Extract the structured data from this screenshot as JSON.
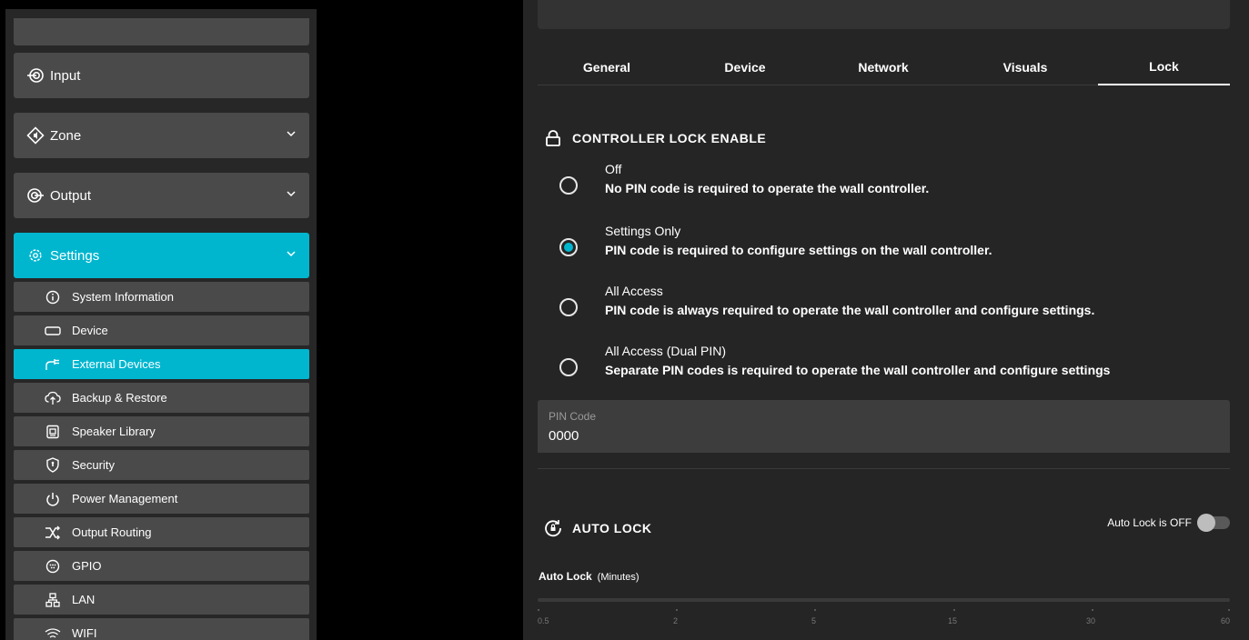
{
  "sidebar": {
    "nav": [
      {
        "label": "Input",
        "icon": "input-icon",
        "has_chevron": false
      },
      {
        "label": "Zone",
        "icon": "zone-icon",
        "has_chevron": true
      },
      {
        "label": "Output",
        "icon": "output-icon",
        "has_chevron": true
      },
      {
        "label": "Settings",
        "icon": "gear-icon",
        "has_chevron": true,
        "active": true
      }
    ],
    "sub": [
      {
        "label": "System Information",
        "icon": "info-icon"
      },
      {
        "label": "Device",
        "icon": "device-icon"
      },
      {
        "label": "External Devices",
        "icon": "external-devices-icon",
        "active": true
      },
      {
        "label": "Backup & Restore",
        "icon": "backup-icon"
      },
      {
        "label": "Speaker Library",
        "icon": "speaker-icon"
      },
      {
        "label": "Security",
        "icon": "shield-icon"
      },
      {
        "label": "Power Management",
        "icon": "power-icon"
      },
      {
        "label": "Output Routing",
        "icon": "routing-icon"
      },
      {
        "label": "GPIO",
        "icon": "gpio-icon"
      },
      {
        "label": "LAN",
        "icon": "lan-icon"
      },
      {
        "label": "WIFI",
        "icon": "wifi-icon"
      }
    ]
  },
  "tabs": [
    {
      "label": "General"
    },
    {
      "label": "Device"
    },
    {
      "label": "Network"
    },
    {
      "label": "Visuals"
    },
    {
      "label": "Lock",
      "active": true
    }
  ],
  "controller_lock": {
    "heading": "CONTROLLER LOCK ENABLE",
    "options": [
      {
        "title": "Off",
        "desc": "No PIN code is required to operate the wall controller.",
        "checked": false
      },
      {
        "title": "Settings Only",
        "desc": "PIN code is required to configure settings on the wall controller.",
        "checked": true
      },
      {
        "title": "All Access",
        "desc": "PIN code is always required to operate the wall controller and configure settings.",
        "checked": false
      },
      {
        "title": "All Access (Dual PIN)",
        "desc": "Separate PIN codes is required to operate the wall controller and configure settings",
        "checked": false
      }
    ]
  },
  "pin": {
    "label": "PIN Code",
    "value": "0000"
  },
  "auto_lock": {
    "heading": "AUTO LOCK",
    "toggle_label": "Auto Lock is OFF",
    "toggle_on": false,
    "slider_label": "Auto Lock",
    "slider_units": "(Minutes)",
    "ticks": [
      "0.5",
      "2",
      "5",
      "15",
      "30",
      "60"
    ]
  },
  "colors": {
    "accent": "#00b6cf",
    "panel": "#252525",
    "item": "#4a4a4a"
  }
}
